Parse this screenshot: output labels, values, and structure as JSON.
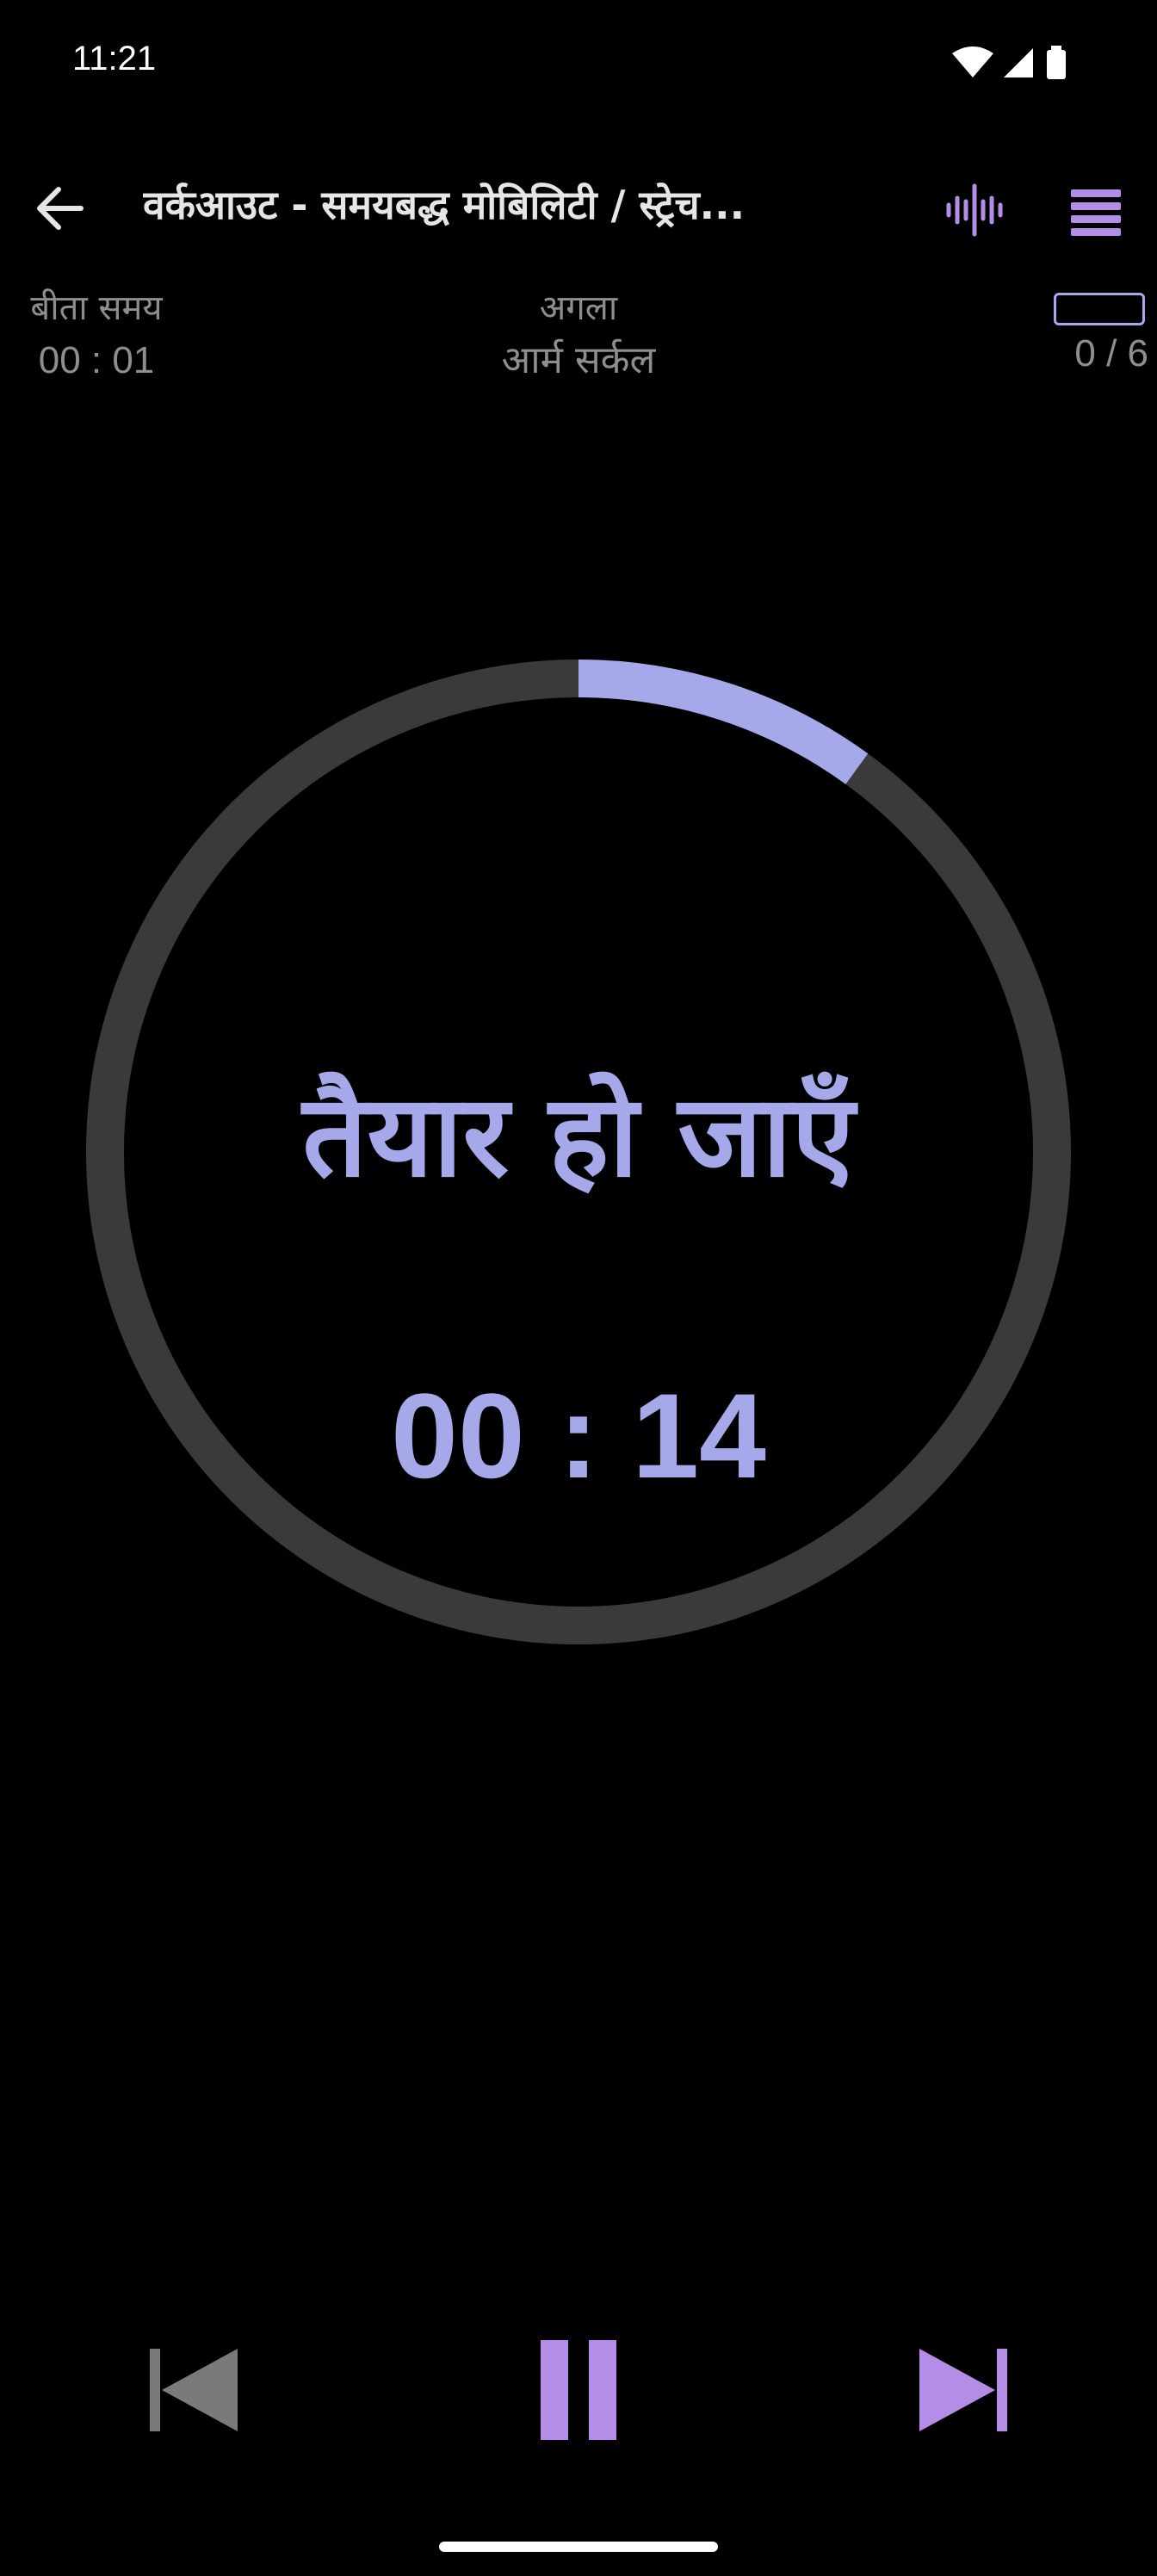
{
  "status_bar": {
    "time": "11:21",
    "icons": [
      "wifi-icon",
      "signal-icon",
      "battery-icon"
    ]
  },
  "toolbar": {
    "back_icon": "arrow-left-icon",
    "title": "वर्कआउट - समयबद्ध मोबिलिटी / स्ट्रेच...",
    "voice_icon": "voice-waveform-icon",
    "menu_icon": "menu-icon"
  },
  "info": {
    "elapsed_label": "बीता समय",
    "elapsed_value": "00 : 01",
    "next_label": "अगला",
    "next_value": "आर्म सर्कल",
    "progress_value": "0 / 6",
    "progress_fraction": 0
  },
  "timer": {
    "status_text": "तैयार हो जाएँ",
    "time": "00 : 14",
    "ring_progress_fraction": 0.1
  },
  "controls": {
    "previous_icon": "skip-previous-icon",
    "pause_icon": "pause-icon",
    "next_icon": "skip-next-icon"
  },
  "colors": {
    "accent": "#a5a9ea",
    "icon_purple": "#b48ee6",
    "ring_track": "#3a3a3a",
    "background": "#000000",
    "muted_text": "#8e8e8e",
    "disabled": "#7a7a7a"
  }
}
